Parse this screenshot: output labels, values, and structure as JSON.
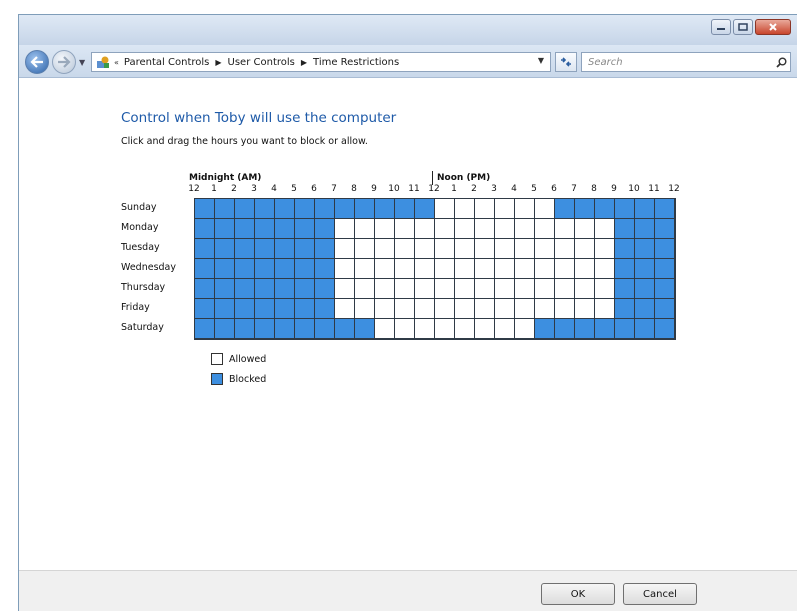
{
  "breadcrumb": [
    "Parental Controls",
    "User Controls",
    "Time Restrictions"
  ],
  "search": {
    "placeholder": "Search"
  },
  "heading": "Control when Toby will use the computer",
  "instruction": "Click and drag the hours you want to block or allow.",
  "periods": {
    "am": "Midnight (AM)",
    "pm": "Noon (PM)"
  },
  "hours": [
    "12",
    "1",
    "2",
    "3",
    "4",
    "5",
    "6",
    "7",
    "8",
    "9",
    "10",
    "11",
    "12",
    "1",
    "2",
    "3",
    "4",
    "5",
    "6",
    "7",
    "8",
    "9",
    "10",
    "11",
    "12"
  ],
  "days": [
    {
      "name": "Sunday",
      "row": "BBBBBBBBBBBBAAAAAABBBBBBB"
    },
    {
      "name": "Monday",
      "row": "BBBBBBBAAAAAAAAAAAAAABBBB"
    },
    {
      "name": "Tuesday",
      "row": "BBBBBBBAAAAAAAAAAAAAABBBB"
    },
    {
      "name": "Wednesday",
      "row": "BBBBBBBAAAAAAAAAAAAAABBBB"
    },
    {
      "name": "Thursday",
      "row": "BBBBBBBAAAAAAAAAAAAAABBBB"
    },
    {
      "name": "Friday",
      "row": "BBBBBBBAAAAAAAAAAAAAABBBB"
    },
    {
      "name": "Saturday",
      "row": "BBBBBBBBBAAAAAAAABBBBBBBB"
    }
  ],
  "legend": [
    {
      "label": "Allowed",
      "color": "#ffffff"
    },
    {
      "label": "Blocked",
      "color": "#3d8fe0"
    }
  ],
  "buttons": {
    "ok": "OK",
    "cancel": "Cancel"
  },
  "colors": {
    "blocked": "#3d8fe0",
    "allowed": "#ffffff",
    "heading": "#1e5aa8"
  }
}
